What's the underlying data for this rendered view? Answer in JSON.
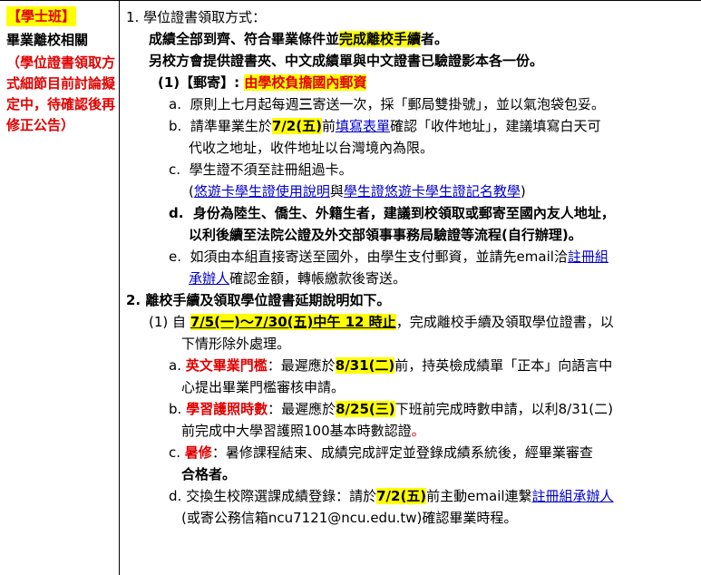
{
  "left": {
    "tag": "【學士班】",
    "category": "畢業離校相關",
    "note": "（學位證書領取方式細節目前討論擬定中，待確認後再修正公告）"
  },
  "s1": {
    "title": "1. 學位證書領取方式：",
    "intro1_pre": "成績全部到齊、符合畢業條件並",
    "intro1_hl": "完成離校手續",
    "intro1_post": "者。",
    "intro2": "另校方會提供證書夾、中文成績單與中文證書已驗證影本各一份。",
    "mail_label": "(1)【郵寄】:",
    "mail_hl": "由學校負擔國內郵資",
    "a_mark": "a.",
    "a_pre": "原則上七月起每週",
    "a_bold": "三",
    "a_post": "寄送一次，採「郵局雙掛號」，並以氣泡袋包妥。",
    "b_mark": "b.",
    "b_pre": "請準畢業生於",
    "b_date": "7/2(五)",
    "b_mid": "前",
    "b_link": "填寫表單",
    "b_post": "確認「收件地址」，建議填寫白天可",
    "b_line2": "代收之地址，收件地址以台灣境內為限。",
    "c_mark": "c.",
    "c_text": "學生證不須至註冊組過卡。",
    "c_paren_open": "(",
    "c_link1": "悠遊卡學生證使用說明",
    "c_and": "與",
    "c_link2": "學生證悠遊卡學生證記名教學",
    "c_paren_close": ")",
    "d_mark": "d.",
    "d_line1": "身份為陸生、僑生、外籍生者，建議到校領取或郵寄至國內友人地址，",
    "d_line2": "以利後續至法院公證及外交部領事事務局驗證等流程(自行辦理)。",
    "e_mark": "e.",
    "e_pre": "如須由本組直接寄送至國外，由學生支付郵資，並請先email洽",
    "e_link1": "註冊組",
    "e_link2": "承辦人",
    "e_post": "確認金額，轉帳繳款後寄送。"
  },
  "s2": {
    "title": "2. 離校手續及領取學位證書延期說明如下。",
    "p1_pre": "(1) 自 ",
    "p1_hl": "7/5(一)～7/30(五)中午 12 時止",
    "p1_post": "，完成離校手續及領取學位證書，以",
    "p1_line2": "下情形除外處理。",
    "a_mark": "a.",
    "a_red": "英文畢業門檻",
    "a_pre": "：最遲應於",
    "a_date": "8/31(二)",
    "a_post": "前，持英檢成績單「正本」向語言中",
    "a_line2": "心提出畢業門檻審核申請。",
    "b_mark": "b.",
    "b_red": "學習護照時數",
    "b_pre": "：最遲應於",
    "b_date": "8/25(三)",
    "b_post": "下班前完成時數申請，以利8/31(二)",
    "b_line2_pre": "前完成中大學習護照100基本時數認證",
    "b_line2_red": "。",
    "c_mark": "c.",
    "c_red": "暑修",
    "c_post": "：暑修課程結束、成績完成評定並登錄成績系統後，經畢業審查",
    "c_line2": "合格者。",
    "d_mark": "d.",
    "d_pre": "交換生校際選課成績登錄：請於",
    "d_date": "7/2(五)",
    "d_post": "前主動email連繫",
    "d_link": "註冊組承辦人",
    "d_line2": "(或寄公務信箱ncu7121@ncu.edu.tw)確認畢業時程。"
  }
}
